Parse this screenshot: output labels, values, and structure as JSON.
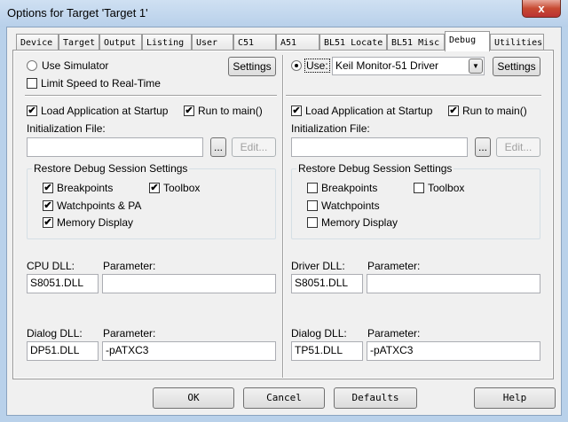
{
  "window": {
    "title": "Options for Target 'Target 1'",
    "close_glyph": "x"
  },
  "tabs": [
    "Device",
    "Target",
    "Output",
    "Listing",
    "User",
    "C51",
    "A51",
    "BL51 Locate",
    "BL51 Misc",
    "Debug",
    "Utilities"
  ],
  "active_tab": "Debug",
  "left": {
    "use_label": "Use Simulator",
    "use_checked": false,
    "settings": "Settings",
    "limit_speed": "Limit Speed to Real-Time",
    "limit_speed_checked": false,
    "load_app": "Load Application at Startup",
    "load_app_checked": true,
    "run_main": "Run to main()",
    "run_main_checked": true,
    "init_label": "Initialization File:",
    "init_value": "",
    "browse": "...",
    "edit": "Edit...",
    "group_title": "Restore Debug Session Settings",
    "breakpoints": "Breakpoints",
    "breakpoints_checked": true,
    "toolbox": "Toolbox",
    "toolbox_checked": true,
    "watchpoints": "Watchpoints & PA",
    "watchpoints_checked": true,
    "memory": "Memory Display",
    "memory_checked": true,
    "dll_label": "CPU DLL:",
    "dll_value": "S8051.DLL",
    "param_label": "Parameter:",
    "param_value": "",
    "dialog_label": "Dialog DLL:",
    "dialog_value": "DP51.DLL",
    "dialog_param_label": "Parameter:",
    "dialog_param_value": "-pATXC3"
  },
  "right": {
    "use_label": "Use:",
    "use_checked": true,
    "driver": "Keil Monitor-51 Driver",
    "settings": "Settings",
    "load_app": "Load Application at Startup",
    "load_app_checked": true,
    "run_main": "Run to main()",
    "run_main_checked": true,
    "init_label": "Initialization File:",
    "init_value": "",
    "browse": "...",
    "edit": "Edit...",
    "group_title": "Restore Debug Session Settings",
    "breakpoints": "Breakpoints",
    "breakpoints_checked": false,
    "toolbox": "Toolbox",
    "toolbox_checked": false,
    "watchpoints": "Watchpoints",
    "watchpoints_checked": false,
    "memory": "Memory Display",
    "memory_checked": false,
    "dll_label": "Driver DLL:",
    "dll_value": "S8051.DLL",
    "param_label": "Parameter:",
    "param_value": "",
    "dialog_label": "Dialog DLL:",
    "dialog_value": "TP51.DLL",
    "dialog_param_label": "Parameter:",
    "dialog_param_value": "-pATXC3"
  },
  "buttons": {
    "ok": "OK",
    "cancel": "Cancel",
    "defaults": "Defaults",
    "help": "Help"
  }
}
